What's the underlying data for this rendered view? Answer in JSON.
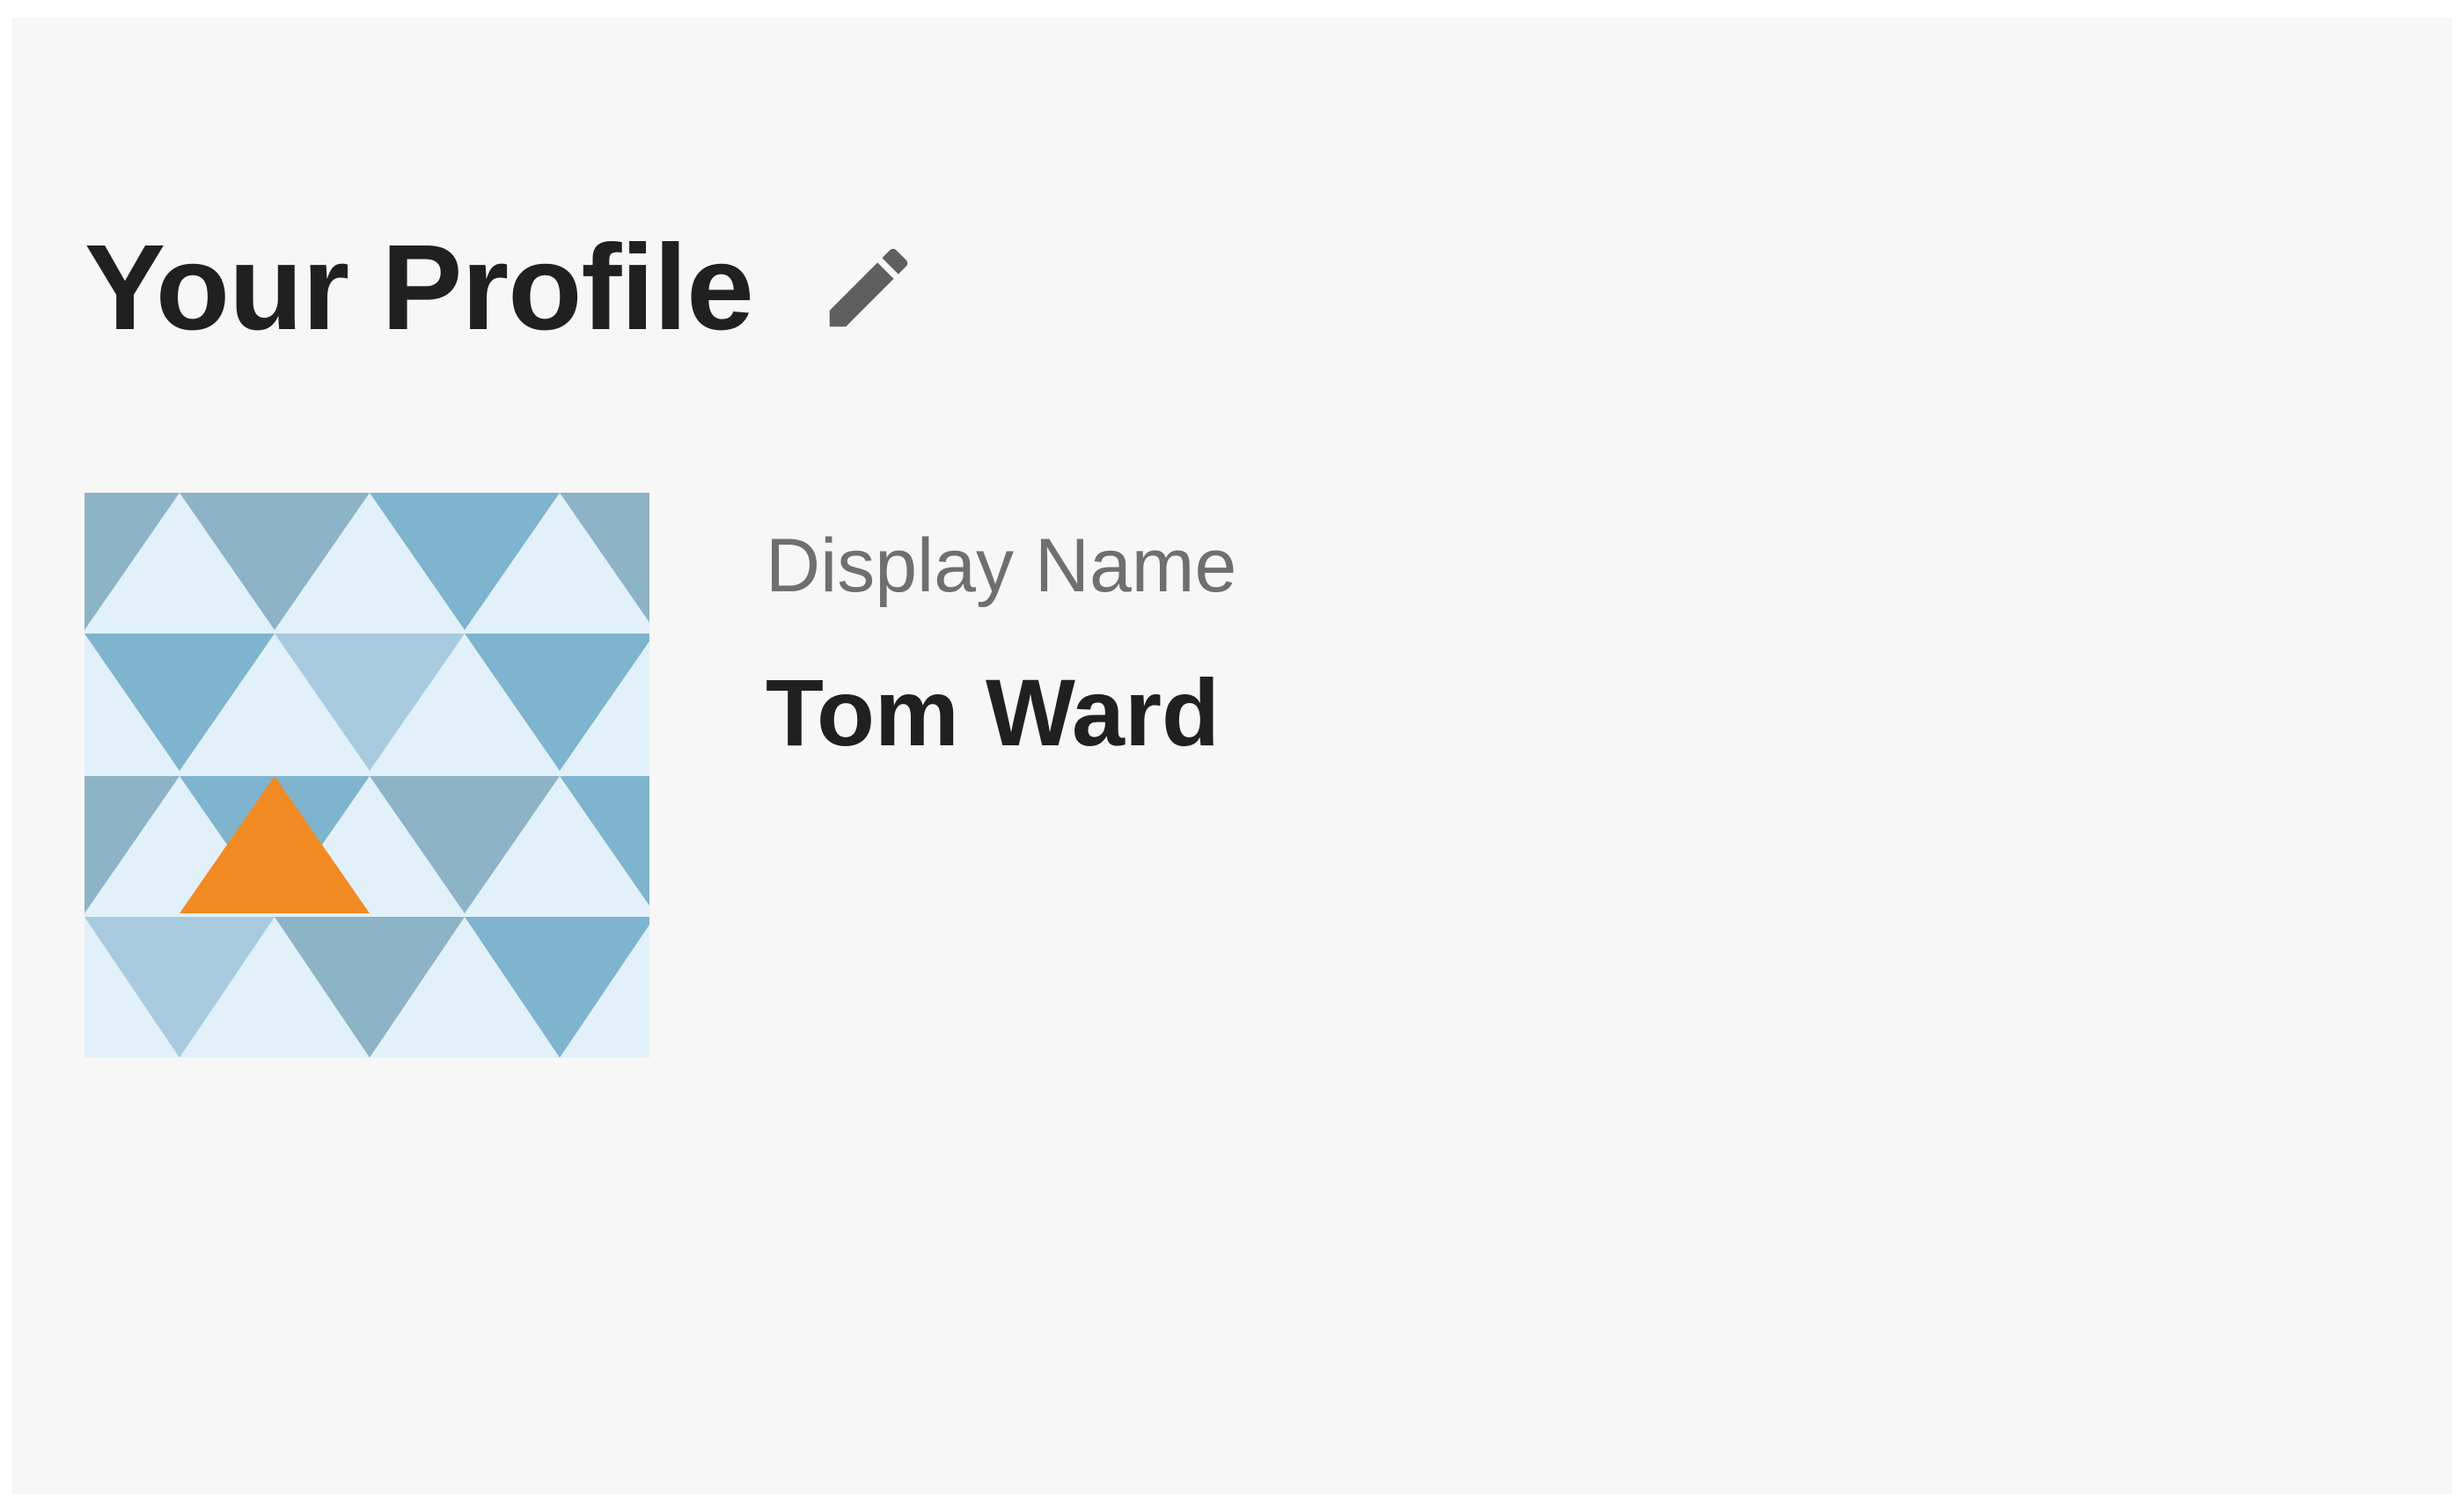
{
  "profile": {
    "title": "Your Profile",
    "edit_icon": "pencil-icon",
    "avatar_icon": "geometric-triangle-avatar",
    "fields": [
      {
        "label": "Display Name",
        "value": "Tom Ward"
      }
    ]
  },
  "colors": {
    "background": "#f7f7f7",
    "title_text": "#202020",
    "label_text": "#6f6f6f",
    "icon": "#5f5f5f",
    "avatar_light": "#e1f0f9",
    "avatar_blue": "#7fb4cf",
    "avatar_grey_blue": "#8db3c7",
    "avatar_pale_blue": "#a7cadf",
    "avatar_accent": "#f28a24"
  }
}
